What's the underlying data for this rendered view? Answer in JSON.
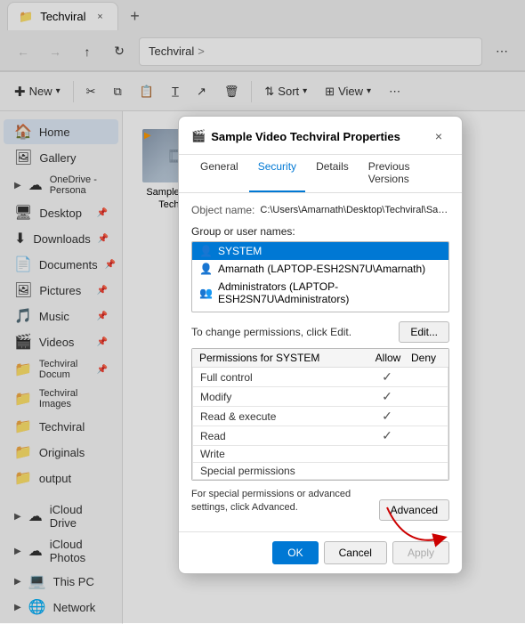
{
  "browser": {
    "tab_label": "Techviral",
    "new_tab_icon": "+",
    "close_icon": "×",
    "nav_back": "←",
    "nav_forward": "→",
    "nav_up": "↑",
    "nav_refresh": "↻",
    "breadcrumb": [
      "Techviral",
      ">"
    ],
    "address_icons": "⋯"
  },
  "toolbar": {
    "new_label": "New",
    "cut_icon": "✂",
    "copy_icon": "⧉",
    "paste_icon": "📋",
    "rename_icon": "T",
    "share_icon": "↗",
    "delete_icon": "🗑",
    "sort_label": "Sort",
    "view_label": "View",
    "more_icon": "⋯"
  },
  "sidebar": {
    "items": [
      {
        "id": "home",
        "label": "Home",
        "icon": "🏠",
        "active": true
      },
      {
        "id": "gallery",
        "label": "Gallery",
        "icon": "🖼"
      },
      {
        "id": "onedrive",
        "label": "OneDrive - Persona",
        "icon": "☁",
        "expandable": true
      }
    ],
    "pinned": [
      {
        "id": "desktop",
        "label": "Desktop",
        "icon": "🖥",
        "pinned": true
      },
      {
        "id": "downloads",
        "label": "Downloads",
        "icon": "⬇",
        "pinned": true
      },
      {
        "id": "documents",
        "label": "Documents",
        "icon": "📄",
        "pinned": true
      },
      {
        "id": "pictures",
        "label": "Pictures",
        "icon": "🖼",
        "pinned": true
      },
      {
        "id": "music",
        "label": "Music",
        "icon": "🎵",
        "pinned": true
      },
      {
        "id": "videos",
        "label": "Videos",
        "icon": "🎬",
        "pinned": true
      },
      {
        "id": "techviral-docum",
        "label": "Techviral Docum",
        "icon": "📁",
        "pinned": true
      },
      {
        "id": "techviral-images",
        "label": "Techviral Images",
        "icon": "📁"
      },
      {
        "id": "techviral",
        "label": "Techviral",
        "icon": "📁"
      },
      {
        "id": "originals",
        "label": "Originals",
        "icon": "📁"
      },
      {
        "id": "output",
        "label": "output",
        "icon": "📁"
      }
    ],
    "cloud": [
      {
        "id": "icloud-drive",
        "label": "iCloud Drive",
        "icon": "☁",
        "expandable": true
      },
      {
        "id": "icloud-photos",
        "label": "iCloud Photos",
        "icon": "☁",
        "expandable": true
      },
      {
        "id": "this-pc",
        "label": "This PC",
        "icon": "💻",
        "expandable": true
      },
      {
        "id": "network",
        "label": "Network",
        "icon": "🌐",
        "expandable": true
      }
    ]
  },
  "file_area": {
    "items": [
      {
        "id": "sample-video",
        "label": "Sample Vide... Techviral",
        "type": "video"
      }
    ]
  },
  "dialog": {
    "title": "Sample Video Techviral Properties",
    "title_icon": "🎬",
    "close_icon": "×",
    "tabs": [
      "General",
      "Security",
      "Details",
      "Previous Versions"
    ],
    "active_tab": "Security",
    "object_name_label": "Object name:",
    "object_name_value": "C:\\Users\\Amarnath\\Desktop\\Techviral\\Sample Vide",
    "group_label": "Group or user names:",
    "users": [
      {
        "id": "system",
        "label": "SYSTEM",
        "icon": "👤",
        "selected": true
      },
      {
        "id": "amarnath",
        "label": "Amarnath (LAPTOP-ESH2SN7U\\Amarnath)",
        "icon": "👤"
      },
      {
        "id": "administrators",
        "label": "Administrators (LAPTOP-ESH2SN7U\\Administrators)",
        "icon": "👥"
      }
    ],
    "perm_change_text": "To change permissions, click Edit.",
    "edit_btn_label": "Edit...",
    "permissions_label": "Permissions for SYSTEM",
    "perm_col_allow": "Allow",
    "perm_col_deny": "Deny",
    "permissions": [
      {
        "name": "Full control",
        "allow": true,
        "deny": false
      },
      {
        "name": "Modify",
        "allow": true,
        "deny": false
      },
      {
        "name": "Read & execute",
        "allow": true,
        "deny": false
      },
      {
        "name": "Read",
        "allow": true,
        "deny": false
      },
      {
        "name": "Write",
        "allow": false,
        "deny": false
      },
      {
        "name": "Special permissions",
        "allow": false,
        "deny": false
      }
    ],
    "advanced_note": "For special permissions or advanced settings, click Advanced.",
    "advanced_btn_label": "Advanced",
    "footer_ok": "OK",
    "footer_cancel": "Cancel",
    "footer_apply": "Apply"
  }
}
